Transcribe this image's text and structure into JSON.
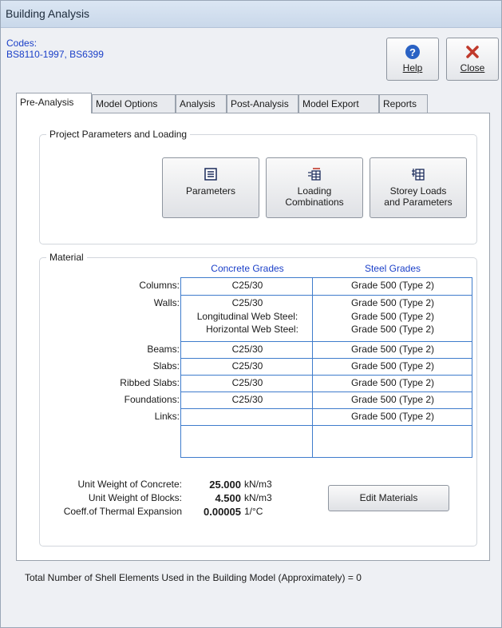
{
  "window": {
    "title": "Building Analysis"
  },
  "codes": {
    "label": "Codes:",
    "value": "BS8110-1997,  BS6399"
  },
  "toolbar": {
    "help_label": "Help",
    "close_label": "Close"
  },
  "tabs": [
    {
      "label": "Pre-Analysis",
      "active": true
    },
    {
      "label": "Model Options",
      "active": false
    },
    {
      "label": "Analysis",
      "active": false
    },
    {
      "label": "Post-Analysis",
      "active": false
    },
    {
      "label": "Model Export",
      "active": false
    },
    {
      "label": "Reports",
      "active": false
    }
  ],
  "project_group": {
    "title": "Project Parameters and Loading",
    "buttons": {
      "parameters": "Parameters",
      "loading_line1": "Loading",
      "loading_line2": "Combinations",
      "storey_line1": "Storey Loads",
      "storey_line2": "and Parameters"
    }
  },
  "material": {
    "title": "Material",
    "concrete_header": "Concrete Grades",
    "steel_header": "Steel Grades",
    "rows": {
      "columns": {
        "label": "Columns:",
        "concrete": "C25/30",
        "steel": "Grade 500 (Type 2)"
      },
      "walls": {
        "label": "Walls:",
        "concrete": "C25/30",
        "steel": "Grade 500 (Type 2)",
        "long_label": "Longitudinal Web Steel:",
        "long_steel": "Grade 500 (Type 2)",
        "horiz_label": "Horizontal Web Steel:",
        "horiz_steel": "Grade 500 (Type 2)"
      },
      "beams": {
        "label": "Beams:",
        "concrete": "C25/30",
        "steel": "Grade 500 (Type 2)"
      },
      "slabs": {
        "label": "Slabs:",
        "concrete": "C25/30",
        "steel": "Grade 500 (Type 2)"
      },
      "ribbed": {
        "label": "Ribbed Slabs:",
        "concrete": "C25/30",
        "steel": "Grade 500 (Type 2)"
      },
      "foundations": {
        "label": "Foundations:",
        "concrete": "C25/30",
        "steel": "Grade 500 (Type 2)"
      },
      "links": {
        "label": "Links:",
        "concrete": "",
        "steel": "Grade 500 (Type 2)"
      }
    },
    "unit_weight_concrete": {
      "label": "Unit Weight of Concrete:",
      "value": "25.000",
      "unit": "kN/m3"
    },
    "unit_weight_blocks": {
      "label": "Unit Weight of Blocks:",
      "value": "4.500",
      "unit": "kN/m3"
    },
    "thermal": {
      "label": "Coeff.of Thermal Expansion",
      "value": "0.00005",
      "unit": "1/°C"
    },
    "edit_button": "Edit Materials"
  },
  "footer": {
    "text": "Total Number of Shell Elements Used in the Building Model (Approximately) = 0"
  },
  "colors": {
    "accent_blue": "#1a3fc8",
    "grid_blue": "#3f7ccc",
    "close_red": "#c0392b",
    "help_blue": "#2a62c4"
  }
}
